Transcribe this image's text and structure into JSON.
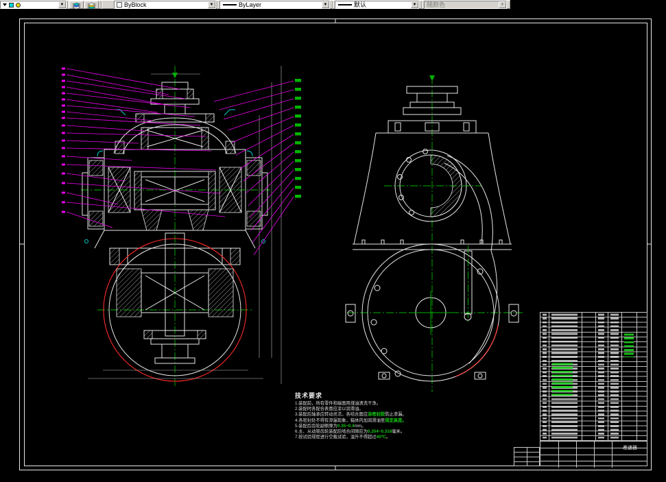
{
  "toolbar": {
    "color_value": "ByBlock",
    "linetype_value": "ByLayer",
    "lineweight_value": "默认",
    "plotstyle_value": "随颜色",
    "arrow_glyph": "▼"
  },
  "colors": {
    "canvas-bg": "#000000",
    "toolbar-bg": "#d6d3ce",
    "line-white": "#e8e8e8",
    "centerline-green": "#00b400",
    "leader-magenta": "#ee00ee",
    "accent-red": "#ff2a2a",
    "accent-cyan": "#00d8d8",
    "hatch-gray": "#9f9f9f",
    "highlight-green": "#14c814"
  },
  "drawing": {
    "tech_requirements": {
      "title": "技术要求",
      "lines": [
        {
          "pre": "1.装配前，所有零件和端面用煤油清洗干净。",
          "hl": "",
          "post": ""
        },
        {
          "pre": "2.装配时各配合表面应涂以润滑油。",
          "hl": "",
          "post": ""
        },
        {
          "pre": "3.装配后轴承应转动灵活，各结合面应",
          "hl": "涂密封胶",
          "post": "防止渗漏。"
        },
        {
          "pre": "4.各密封处不得有渗漏现象，箱体内加润滑油至",
          "hl": "规定高度。",
          "post": ""
        },
        {
          "pre": "5.装配后齿轮副侧隙为",
          "hl": "0.35~0.4",
          "post": "mm。"
        },
        {
          "pre": "6.主、从动锥齿轮装配后啮合间隙应为",
          "hl": "0.204~0.318",
          "post": "毫米。"
        },
        {
          "pre": "7.按试验规程进行空载试验，温升不得超过",
          "hl": "40℃",
          "post": "。"
        }
      ]
    },
    "title_block": {
      "part_name": "差速器"
    }
  }
}
